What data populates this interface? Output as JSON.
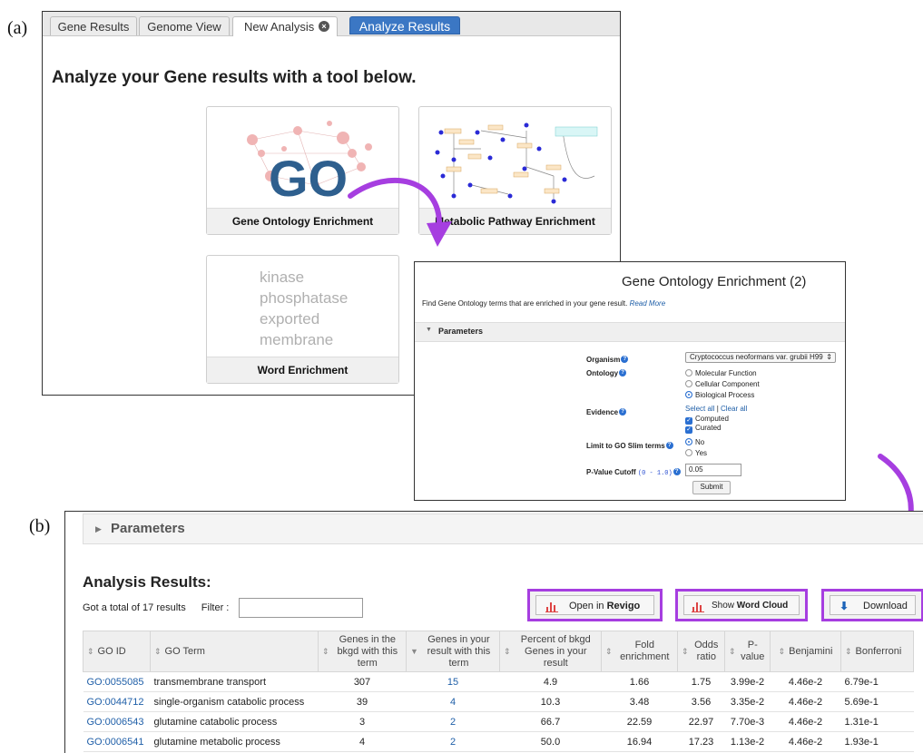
{
  "labels": {
    "a": "(a)",
    "b": "(b)"
  },
  "panel_a": {
    "tabs": [
      "Gene Results",
      "Genome View",
      "New Analysis"
    ],
    "close_symbol": "×",
    "analyze_button": "Analyze Results",
    "headline": "Analyze your Gene results with a tool below.",
    "cards": {
      "go_caption": "Gene Ontology Enrichment",
      "go_logo": "GO",
      "pathway_caption": "Metabolic Pathway Enrichment",
      "word_caption": "Word Enrichment",
      "words": [
        "kinase",
        "phosphatase",
        "exported",
        "membrane"
      ]
    }
  },
  "go_form": {
    "title": "Gene Ontology Enrichment (2)",
    "description": "Find Gene Ontology terms that are enriched in your gene result.",
    "read_more": "Read More",
    "parameters": "Parameters",
    "organism_label": "Organism",
    "organism_value": "Cryptococcus neoformans var. grubii H99",
    "ontology_label": "Ontology",
    "ontology_options": [
      "Molecular Function",
      "Cellular Component",
      "Biological Process"
    ],
    "ontology_selected": "Biological Process",
    "evidence_label": "Evidence",
    "select_all": "Select all",
    "clear_all": "Clear all",
    "evidence_options": [
      "Computed",
      "Curated"
    ],
    "slim_label": "Limit to GO Slim terms",
    "slim_options": [
      "No",
      "Yes"
    ],
    "pvalue_label": "P-Value Cutoff",
    "pvalue_hint": "(0 - 1.0)",
    "pvalue_value": "0.05",
    "submit": "Submit"
  },
  "panel_b": {
    "parameters": "Parameters",
    "title": "Analysis Results:",
    "count_text": "Got a total of 17 results",
    "filter_label": "Filter :",
    "open_in": "Open in",
    "revigo": "Revigo",
    "show": "Show",
    "word_cloud": "Word Cloud",
    "download": "Download",
    "headers": [
      "GO ID",
      "GO Term",
      "Genes in the bkgd with this term",
      "Genes in your result with this term",
      "Percent of bkgd Genes in your result",
      "Fold enrichment",
      "Odds ratio",
      "P-value",
      "Benjamini",
      "Bonferroni"
    ],
    "rows": [
      [
        "GO:0055085",
        "transmembrane transport",
        "307",
        "15",
        "4.9",
        "1.66",
        "1.75",
        "3.99e-2",
        "4.46e-2",
        "6.79e-1"
      ],
      [
        "GO:0044712",
        "single-organism catabolic process",
        "39",
        "4",
        "10.3",
        "3.48",
        "3.56",
        "3.35e-2",
        "4.46e-2",
        "5.69e-1"
      ],
      [
        "GO:0006543",
        "glutamine catabolic process",
        "3",
        "2",
        "66.7",
        "22.59",
        "22.97",
        "7.70e-3",
        "4.46e-2",
        "1.31e-1"
      ],
      [
        "GO:0006541",
        "glutamine metabolic process",
        "4",
        "2",
        "50.0",
        "16.94",
        "17.23",
        "1.13e-2",
        "4.46e-2",
        "1.93e-1"
      ]
    ]
  },
  "colors": {
    "accent_purple": "#a63ee0",
    "link_blue": "#1f5fa8",
    "button_blue": "#3b77c4"
  }
}
